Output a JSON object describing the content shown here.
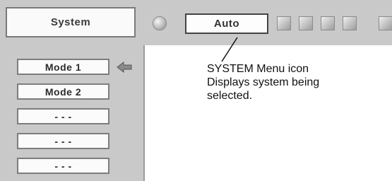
{
  "header": {
    "panel_title": "System",
    "current_mode": "Auto",
    "toolbar_icons": [
      "rotate-icon",
      "menu-icon",
      "image-icon",
      "screen-icon",
      "setting-icon"
    ]
  },
  "mode_list": [
    {
      "label": "Mode 1",
      "selected": true
    },
    {
      "label": "Mode 2",
      "selected": false
    },
    {
      "label": "- - -",
      "selected": false
    },
    {
      "label": "- - -",
      "selected": false
    },
    {
      "label": "- - -",
      "selected": false
    }
  ],
  "caption": {
    "lines": [
      "SYSTEM Menu icon",
      "Displays system being",
      "selected."
    ]
  },
  "colors": {
    "panel_gray": "#c9c9c9",
    "button_face": "#fafafa",
    "text_dark": "#2c2c2c"
  }
}
